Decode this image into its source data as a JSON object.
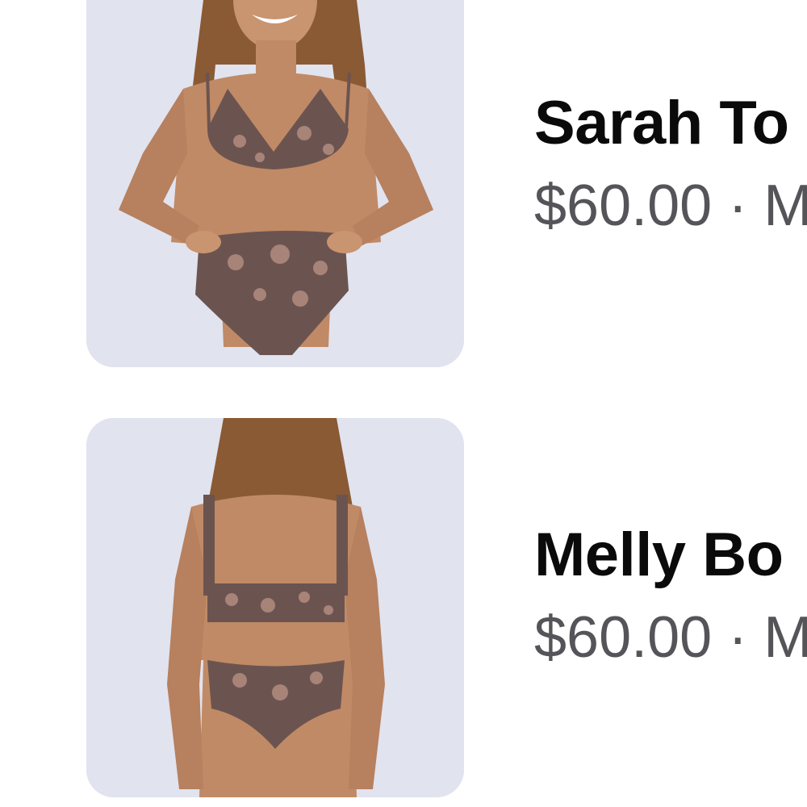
{
  "products": [
    {
      "name": "Sarah To",
      "price": "$60.00",
      "separator": "·",
      "meta": "M",
      "image": "model-front-view-swimwear"
    },
    {
      "name": "Melly Bo",
      "price": "$60.00",
      "separator": "·",
      "meta": "M",
      "image": "model-back-view-swimwear"
    }
  ],
  "colors": {
    "thumb_bg": "#e1e3ef",
    "skin": "#c08a66",
    "swimwear": "#6b5450",
    "swimwear_pattern": "#a88378",
    "hair": "#8a5a34",
    "title": "#0a0a0a",
    "subtitle": "#555559"
  }
}
